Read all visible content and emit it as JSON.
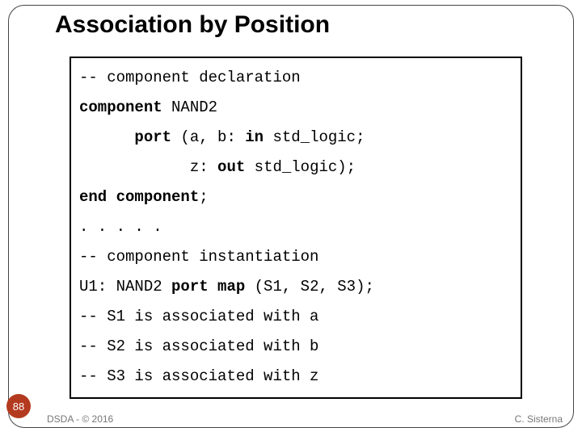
{
  "title": "Association by Position",
  "code": {
    "l1": "-- component declaration",
    "l2a": "component",
    "l2b": " NAND2",
    "l3_indent": "      ",
    "l3a": "port",
    "l3b": " (a, b: ",
    "l3c": "in",
    "l3d": " std_logic;",
    "l4_indent": "            ",
    "l4a": "z: ",
    "l4b": "out",
    "l4c": " std_logic);",
    "l5a": "end component",
    "l5b": ";",
    "l6": ". . . . .",
    "l7": "-- component instantiation",
    "l8a": "U1: NAND2 ",
    "l8b": "port map",
    "l8c": " (S1, S2, S3);",
    "l9": "-- S1 is associated with a",
    "l10": "-- S2 is associated with b",
    "l11": "-- S3 is associated with z"
  },
  "page_number": "88",
  "footer_left": "DSDA - © 2016",
  "footer_right": "C. Sisterna"
}
